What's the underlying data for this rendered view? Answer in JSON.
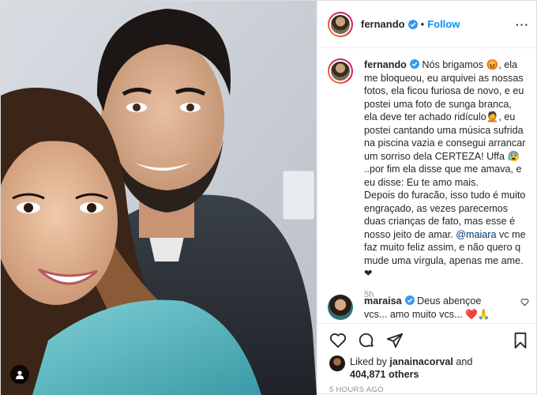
{
  "header": {
    "username": "fernando",
    "follow_label": "Follow",
    "separator": "•",
    "more_label": "···"
  },
  "caption": {
    "username": "fernando",
    "text_1": "Nós brigamos 😡, ela me bloqueou, eu arquivei as nossas fotos, ela ficou furiosa de novo, e eu postei uma foto de sunga branca, ela deve ter achado ridículo🤦, eu postei cantando uma música sufrida na piscina vazia e consegui arrancar um sorriso dela CERTEZA! Uffa 😰 ..por fim ela disse que me amava, e eu disse: Eu te amo mais.",
    "text_2_before": "Depois do furacão, isso tudo é muito engraçado, as vezes parecemos duas crianças de fato, mas esse é nosso jeito de amar. ",
    "mention": "@maiara",
    "text_2_after": " vc me faz muito feliz assim, e não quero q mude uma vírgula, apenas me ame.",
    "text_3": "❤",
    "time_ago": "5h"
  },
  "comment": {
    "username": "maraisa",
    "text": "Deus abençoe vcs... amo muito vcs... ❤️🙏"
  },
  "likes": {
    "prefix": "Liked by ",
    "liker": "janainacorval",
    "and": " and",
    "count": "404,871 others"
  },
  "timestamp": "5 HOURS AGO",
  "icons": {
    "like": "heart-icon",
    "comment": "comment-icon",
    "share": "share-icon",
    "save": "bookmark-icon",
    "user_tag": "user-tag-icon",
    "verified": "verified-badge-icon"
  },
  "colors": {
    "link": "#0095f6",
    "mention": "#00376b",
    "verified": "#3897f0",
    "muted": "#8e8e8e"
  }
}
